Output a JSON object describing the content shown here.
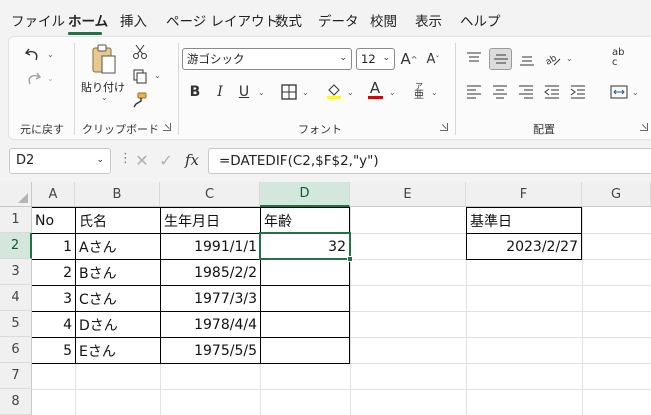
{
  "tabs": [
    "ファイル",
    "ホーム",
    "挿入",
    "ページ レイアウト",
    "数式",
    "データ",
    "校閲",
    "表示",
    "ヘルプ"
  ],
  "active_tab": "ホーム",
  "ribbon": {
    "undo_group_label": "元に戻す",
    "clipboard": {
      "label": "クリップボード",
      "paste_label": "貼り付け"
    },
    "font": {
      "label": "フォント",
      "name": "游ゴシック",
      "size": "12",
      "bold": "B",
      "italic": "I",
      "underline": "U",
      "grow": "A",
      "shrink": "A",
      "font_color_glyph": "A",
      "phonetic_top": "ア",
      "phonetic_bottom": "亜"
    },
    "alignment": {
      "label": "配置",
      "wrap_glyph": "ab c"
    }
  },
  "formula_bar": {
    "name_box": "D2",
    "fx_label": "fx",
    "formula": "=DATEDIF(C2,$F$2,\"y\")"
  },
  "columns": [
    "A",
    "B",
    "C",
    "D",
    "E",
    "F",
    "G"
  ],
  "rows": [
    "1",
    "2",
    "3",
    "4",
    "5",
    "6",
    "7",
    "8"
  ],
  "cells": {
    "A1": "No",
    "B1": "氏名",
    "C1": "生年月日",
    "D1": "年齢",
    "A2": "1",
    "B2": "Aさん",
    "C2": "1991/1/1",
    "D2": "32",
    "A3": "2",
    "B3": "Bさん",
    "C3": "1985/2/2",
    "A4": "3",
    "B4": "Cさん",
    "C4": "1977/3/3",
    "A5": "4",
    "B5": "Dさん",
    "C5": "1978/4/4",
    "A6": "5",
    "B6": "Eさん",
    "C6": "1975/5/5",
    "F1": "基準日",
    "F2": "2023/2/27"
  },
  "selected_cell": "D2",
  "colors": {
    "accent": "#217346",
    "font_color_underline": "#e00000",
    "highlight_underline": "#ffff00"
  }
}
